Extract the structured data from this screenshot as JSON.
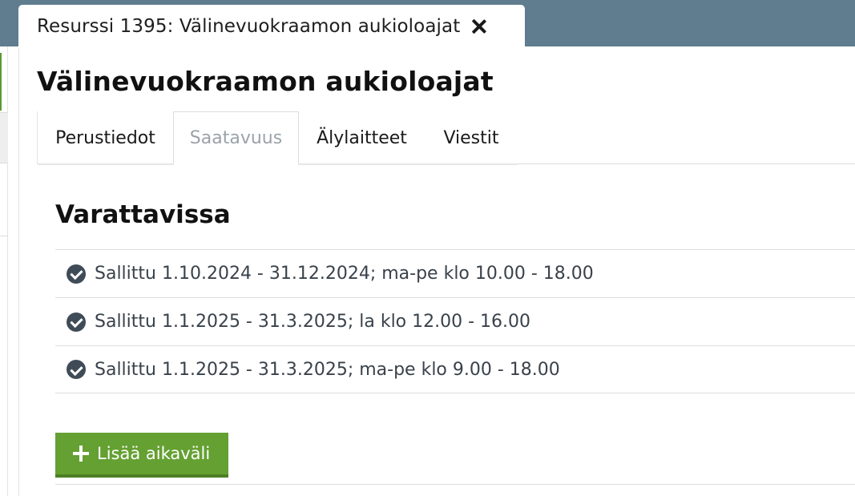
{
  "window_tab": {
    "title": "Resurssi 1395: Välinevuokraamon aukioloajat"
  },
  "page_title": "Välinevuokraamon aukioloajat",
  "tabs": [
    {
      "label": "Perustiedot",
      "active": false
    },
    {
      "label": "Saatavuus",
      "active": true
    },
    {
      "label": "Älylaitteet",
      "active": false
    },
    {
      "label": "Viestit",
      "active": false
    }
  ],
  "section": {
    "title": "Varattavissa",
    "rows": [
      {
        "icon": "check-circle-icon",
        "text": "Sallittu 1.10.2024 - 31.12.2024; ma-pe klo 10.00 - 18.00"
      },
      {
        "icon": "check-circle-icon",
        "text": "Sallittu 1.1.2025 - 31.3.2025; la klo 12.00 - 16.00"
      },
      {
        "icon": "check-circle-icon",
        "text": "Sallittu 1.1.2025 - 31.3.2025; ma-pe klo 9.00 - 18.00"
      }
    ]
  },
  "add_button": {
    "label": "Lisää aikaväli",
    "icon": "plus-icon"
  },
  "colors": {
    "topbar": "#607d8f",
    "accent_green": "#65a032",
    "check_icon": "#3f4b57"
  }
}
